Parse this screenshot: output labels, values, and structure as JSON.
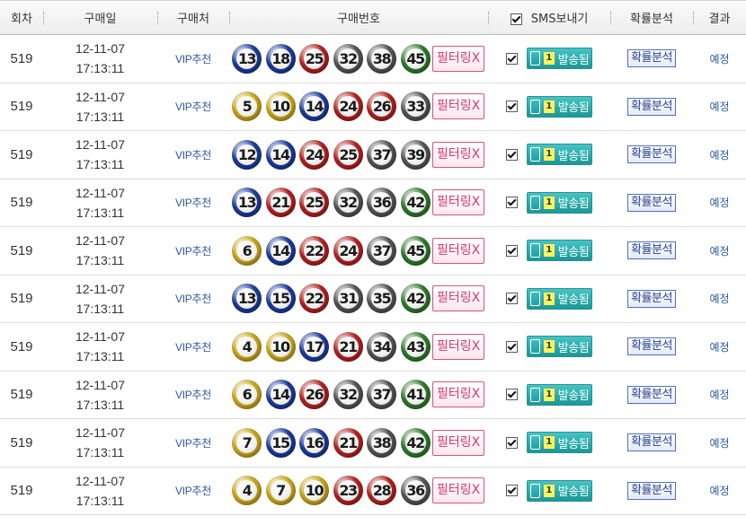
{
  "header": {
    "round": "회차",
    "date": "구매일",
    "place": "구매처",
    "numbers": "구매번호",
    "sms": "SMS보내기",
    "analysis": "확률분석",
    "result": "결과"
  },
  "ball_colors": {
    "yellow": "#c9a81e",
    "blue": "#1d3c9b",
    "red": "#b32222",
    "gray": "#555555",
    "green": "#2f7a2f"
  },
  "rows": [
    {
      "round": "519",
      "date": "12-11-07",
      "time": "17:13:11",
      "place": "VIP추천",
      "numbers": [
        "13",
        "18",
        "25",
        "32",
        "38",
        "45"
      ],
      "filter": "필터링X",
      "sms_count": "1",
      "sms_status": "발송됨",
      "analysis": "확률분석",
      "result": "예정"
    },
    {
      "round": "519",
      "date": "12-11-07",
      "time": "17:13:11",
      "place": "VIP추천",
      "numbers": [
        "5",
        "10",
        "14",
        "24",
        "26",
        "33"
      ],
      "filter": "필터링X",
      "sms_count": "1",
      "sms_status": "발송됨",
      "analysis": "확률분석",
      "result": "예정"
    },
    {
      "round": "519",
      "date": "12-11-07",
      "time": "17:13:11",
      "place": "VIP추천",
      "numbers": [
        "12",
        "14",
        "24",
        "25",
        "37",
        "39"
      ],
      "filter": "필터링X",
      "sms_count": "1",
      "sms_status": "발송됨",
      "analysis": "확률분석",
      "result": "예정"
    },
    {
      "round": "519",
      "date": "12-11-07",
      "time": "17:13:11",
      "place": "VIP추천",
      "numbers": [
        "13",
        "21",
        "25",
        "32",
        "36",
        "42"
      ],
      "filter": "필터링X",
      "sms_count": "1",
      "sms_status": "발송됨",
      "analysis": "확률분석",
      "result": "예정"
    },
    {
      "round": "519",
      "date": "12-11-07",
      "time": "17:13:11",
      "place": "VIP추천",
      "numbers": [
        "6",
        "14",
        "22",
        "24",
        "37",
        "45"
      ],
      "filter": "필터링X",
      "sms_count": "1",
      "sms_status": "발송됨",
      "analysis": "확률분석",
      "result": "예정"
    },
    {
      "round": "519",
      "date": "12-11-07",
      "time": "17:13:11",
      "place": "VIP추천",
      "numbers": [
        "13",
        "15",
        "22",
        "31",
        "35",
        "42"
      ],
      "filter": "필터링X",
      "sms_count": "1",
      "sms_status": "발송됨",
      "analysis": "확률분석",
      "result": "예정"
    },
    {
      "round": "519",
      "date": "12-11-07",
      "time": "17:13:11",
      "place": "VIP추천",
      "numbers": [
        "4",
        "10",
        "17",
        "21",
        "34",
        "43"
      ],
      "filter": "필터링X",
      "sms_count": "1",
      "sms_status": "발송됨",
      "analysis": "확률분석",
      "result": "예정"
    },
    {
      "round": "519",
      "date": "12-11-07",
      "time": "17:13:11",
      "place": "VIP추천",
      "numbers": [
        "6",
        "14",
        "26",
        "32",
        "37",
        "41"
      ],
      "filter": "필터링X",
      "sms_count": "1",
      "sms_status": "발송됨",
      "analysis": "확률분석",
      "result": "예정"
    },
    {
      "round": "519",
      "date": "12-11-07",
      "time": "17:13:11",
      "place": "VIP추천",
      "numbers": [
        "7",
        "15",
        "16",
        "21",
        "38",
        "42"
      ],
      "filter": "필터링X",
      "sms_count": "1",
      "sms_status": "발송됨",
      "analysis": "확률분석",
      "result": "예정"
    },
    {
      "round": "519",
      "date": "12-11-07",
      "time": "17:13:11",
      "place": "VIP추천",
      "numbers": [
        "4",
        "7",
        "10",
        "23",
        "28",
        "36"
      ],
      "filter": "필터링X",
      "sms_count": "1",
      "sms_status": "발송됨",
      "analysis": "확률분석",
      "result": "예정"
    }
  ]
}
